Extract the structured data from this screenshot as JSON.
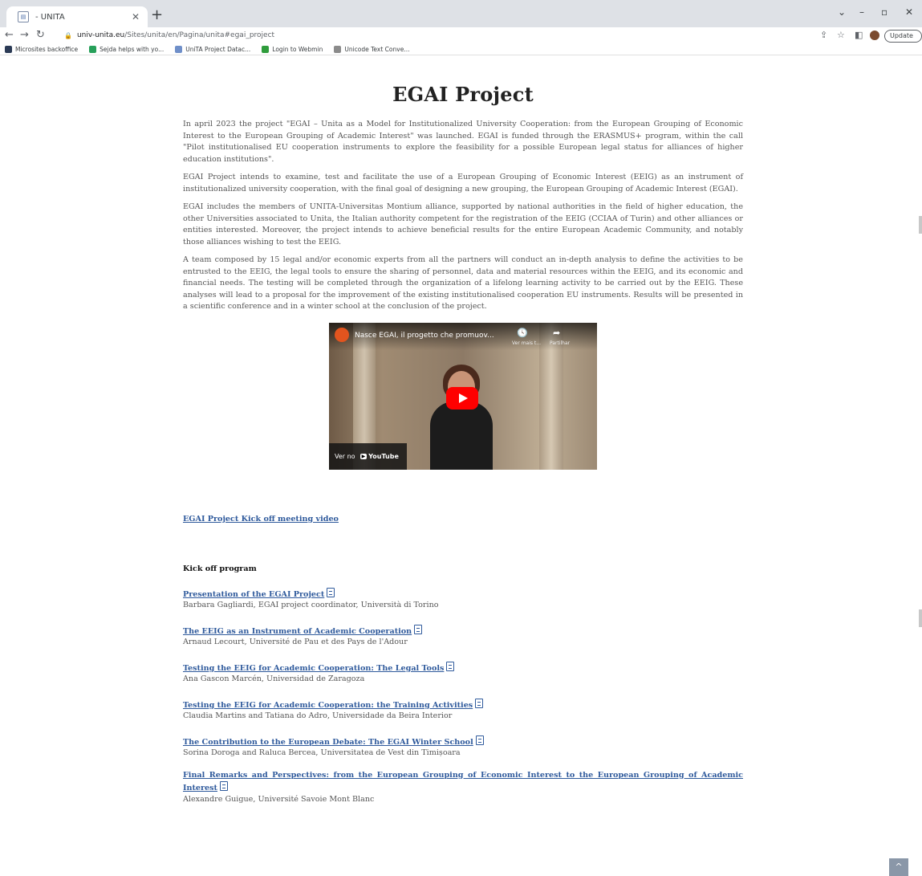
{
  "browser": {
    "tab_title": "- UNITA",
    "url_host": "univ-unita.eu",
    "url_path": "/Sites/unita/en/Pagina/unita#egai_project",
    "update_label": "Update",
    "bookmarks": [
      {
        "label": "Microsites backoffice",
        "color": "#2b3a55"
      },
      {
        "label": "Sejda helps with yo...",
        "color": "#27a05a"
      },
      {
        "label": "UniTA Project Datac...",
        "color": "#6f8fc9"
      },
      {
        "label": "Login to Webmin",
        "color": "#2f9c3c"
      },
      {
        "label": "Unicode Text Conve...",
        "color": "#8b8b8b"
      }
    ]
  },
  "page": {
    "title": "EGAI Project",
    "paragraphs": [
      "In april 2023 the project \"EGAI – Unita as a Model for Institutionalized University Cooperation: from the European Grouping of Economic Interest to the European Grouping of Academic Interest\" was launched. EGAI is funded through the ERASMUS+ program, within the call \"Pilot institutionalised EU cooperation instruments to explore the feasibility for a possible European legal status for alliances of higher education institutions\".",
      "EGAI Project intends to examine, test and facilitate the use of a European Grouping of Economic Interest (EEIG) as an instrument of institutionalized university cooperation, with the final goal of designing a new grouping, the European Grouping of Academic Interest (EGAI).",
      "EGAI includes the members of UNITA-Universitas Montium alliance, supported by national authorities in the field of higher education, the other Universities associated to Unita, the Italian authority competent for the registration of the EEIG (CCIAA of Turin) and other alliances or entities interested. Moreover, the project intends to achieve beneficial results for the entire European Academic Community, and notably those alliances wishing to test the EEIG.",
      "A team composed by 15 legal and/or economic experts from all the partners will conduct an in-depth analysis to define the activities to be entrusted to the EEIG, the legal tools to ensure the sharing of personnel, data and material resources within the EEIG, and its economic and financial needs. The testing will be completed through the organization of a lifelong learning activity to be carried out by the EEIG. These analyses will lead to a proposal for the improvement of the existing institutionalised cooperation EU instruments. Results will be presented in a scientific conference and in a winter school at the conclusion of the project."
    ],
    "video": {
      "title": "Nasce EGAI, il progetto che promuov...",
      "watch_later": "Ver mais t...",
      "share": "Partilhar",
      "watch_on": "Ver no",
      "youtube": "YouTube"
    },
    "kickoff_video_link": "EGAI Project Kick off meeting video",
    "program_heading": "Kick off program",
    "program": [
      {
        "title": "Presentation of the EGAI Project",
        "speaker": "Barbara Gagliardi, EGAI project coordinator, Università di Torino"
      },
      {
        "title": "The EEIG as an Instrument of Academic Cooperation",
        "speaker": "Arnaud Lecourt, Université de Pau et des Pays de l'Adour"
      },
      {
        "title": "Testing the EEIG for Academic Cooperation: The Legal Tools",
        "speaker": "Ana Gascon Marcén, Universidad de Zaragoza"
      },
      {
        "title": "Testing the EEIG for Academic Cooperation: the Training Activities",
        "speaker": "Claudia Martins and Tatiana do Adro, Universidade da Beira Interior"
      },
      {
        "title": "The Contribution to the European Debate: The EGAI Winter School",
        "speaker": "Sorina Doroga and Raluca Bercea, Universitatea de Vest din Timișoara"
      },
      {
        "title": "Final Remarks and Perspectives: from the European Grouping of Economic Interest to the European Grouping of Academic Interest",
        "speaker": "Alexandre Guigue, Université Savoie Mont Blanc"
      }
    ]
  }
}
